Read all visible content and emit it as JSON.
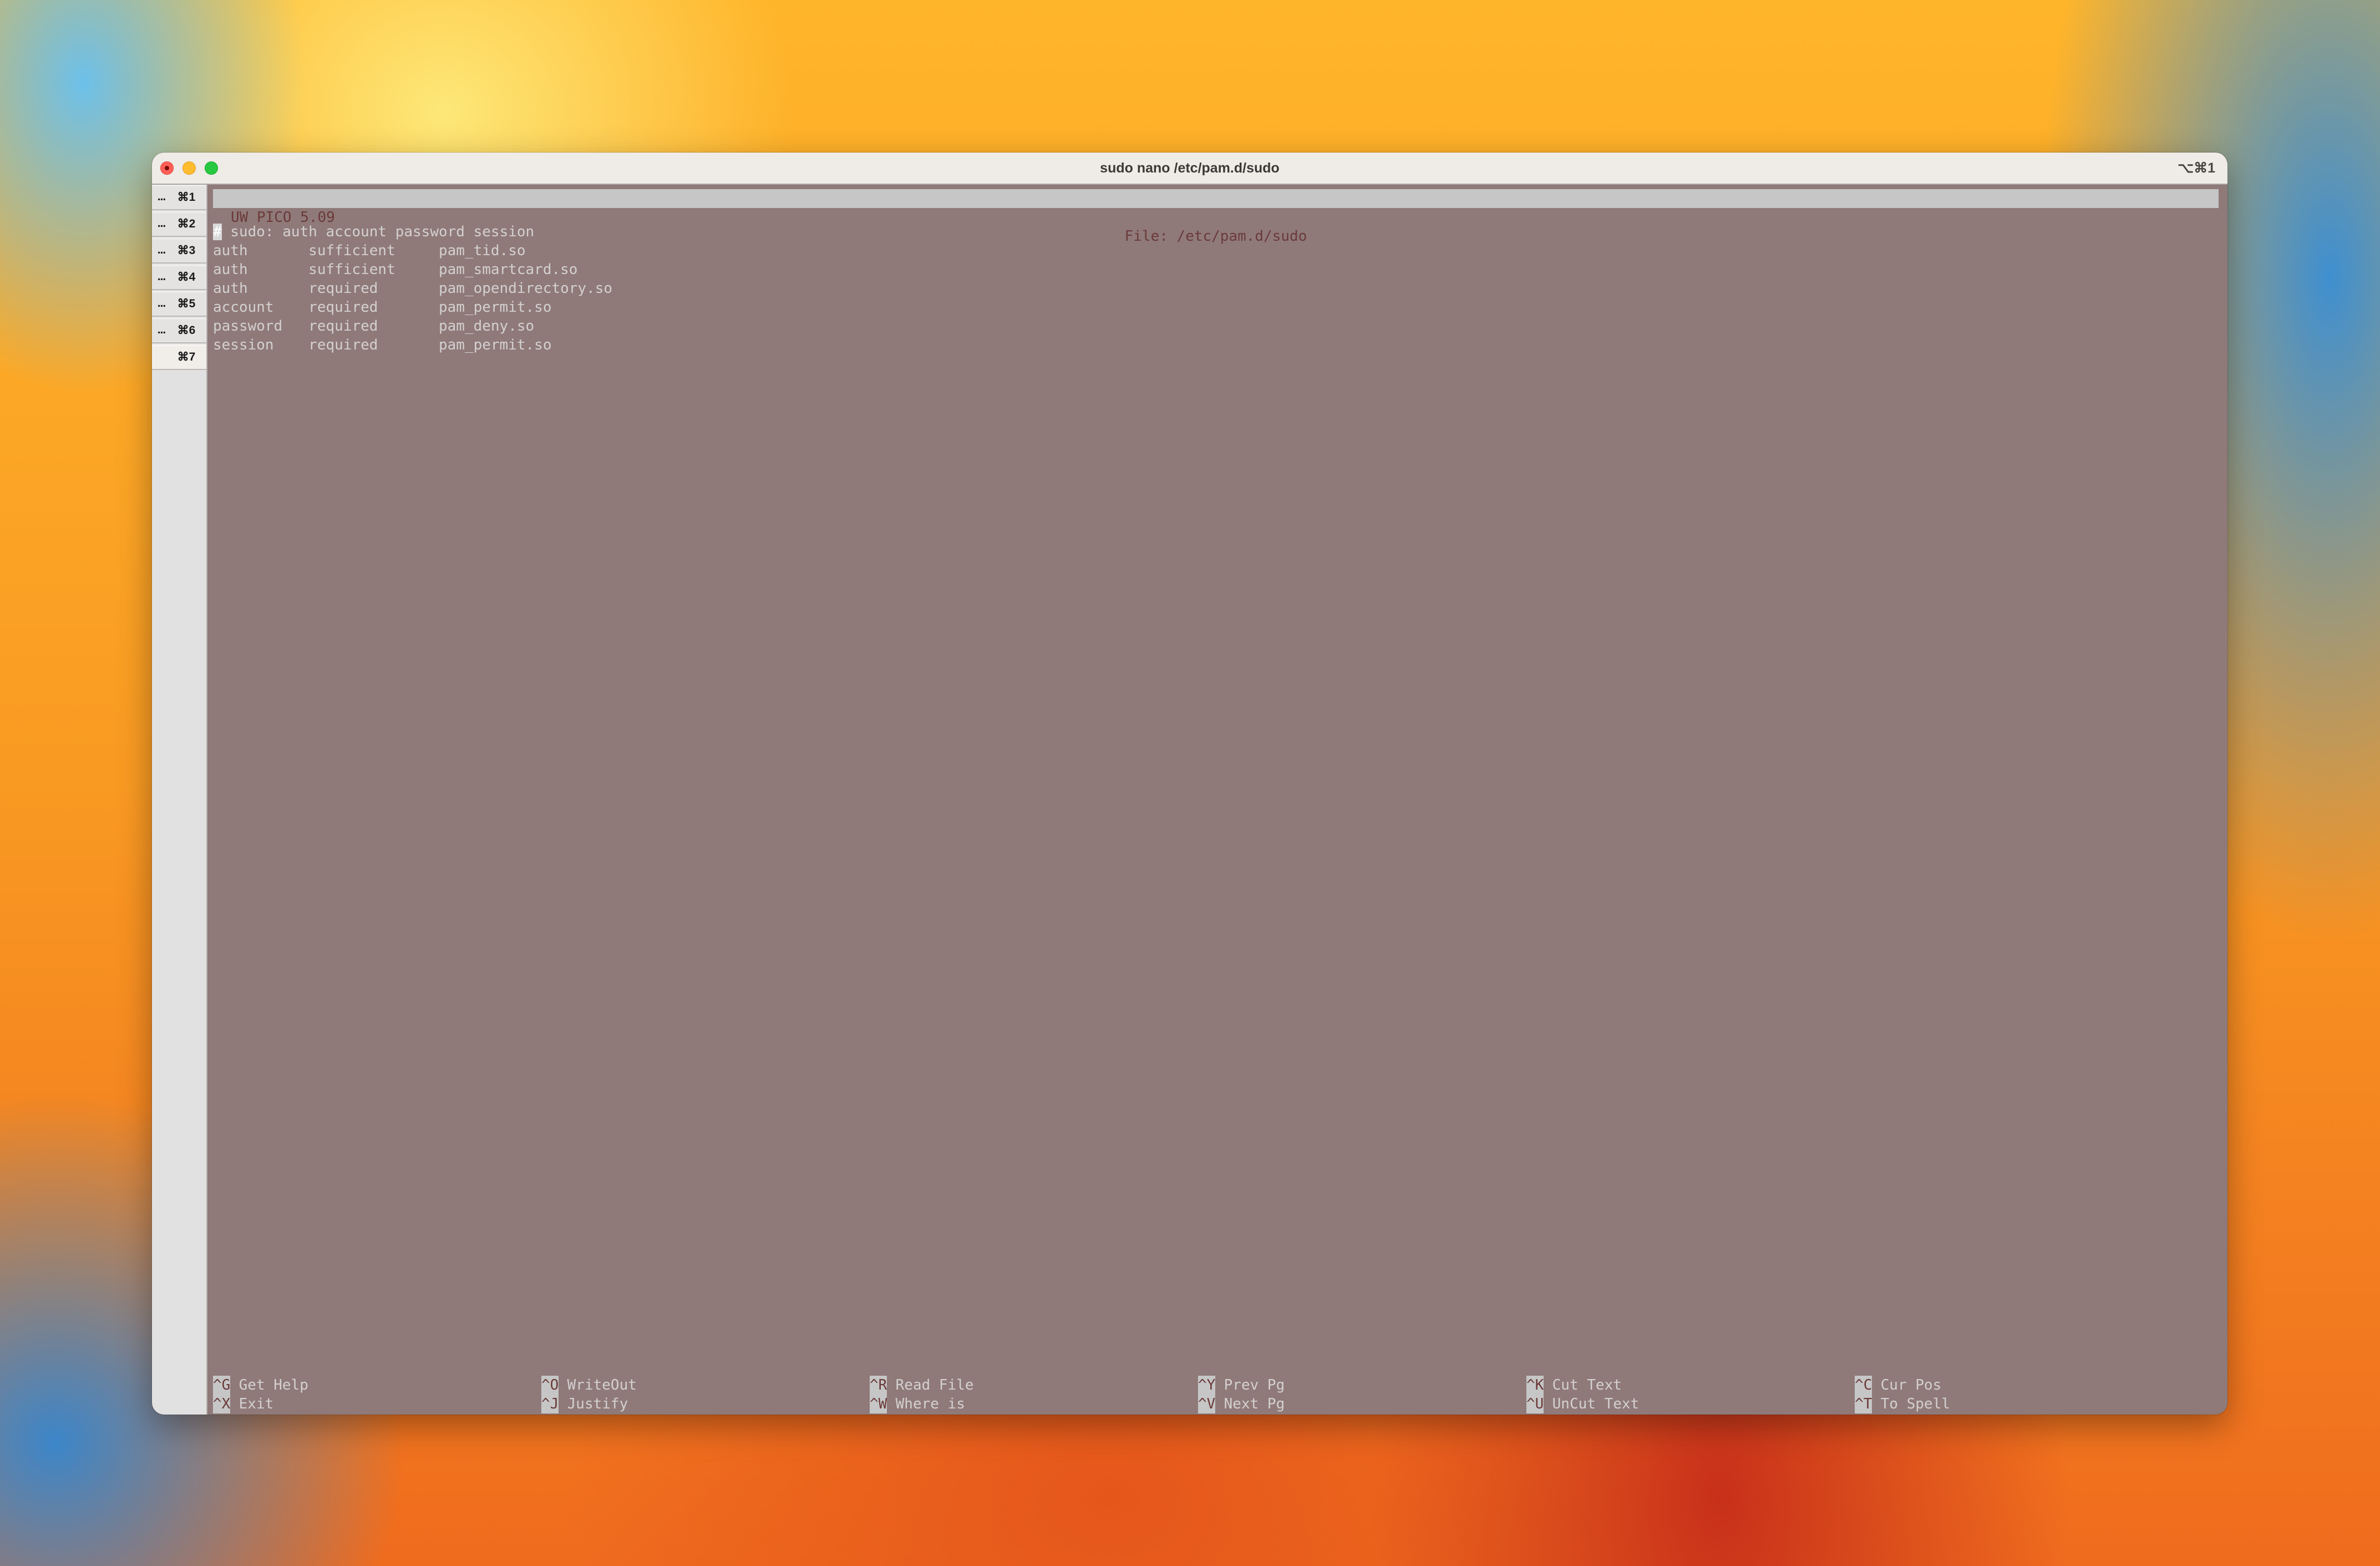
{
  "window": {
    "title": "sudo nano /etc/pam.d/sudo",
    "shortcut": "⌥⌘1"
  },
  "tabs": [
    {
      "dots": "...",
      "key": "⌘1",
      "active": false
    },
    {
      "dots": "...",
      "key": "⌘2",
      "active": false
    },
    {
      "dots": "...",
      "key": "⌘3",
      "active": false
    },
    {
      "dots": "...",
      "key": "⌘4",
      "active": false
    },
    {
      "dots": "...",
      "key": "⌘5",
      "active": false
    },
    {
      "dots": "...",
      "key": "⌘6",
      "active": false
    },
    {
      "dots": "",
      "key": "⌘7",
      "active": true
    }
  ],
  "editor": {
    "version": "UW PICO 5.09",
    "file_label": "File: /etc/pam.d/sudo",
    "cursor_char": "#",
    "first_line_rest": " sudo: auth account password session",
    "lines": [
      "auth       sufficient     pam_tid.so",
      "auth       sufficient     pam_smartcard.so",
      "auth       required       pam_opendirectory.so",
      "account    required       pam_permit.so",
      "password   required       pam_deny.so",
      "session    required       pam_permit.so"
    ]
  },
  "help": [
    {
      "top": {
        "key": "^G",
        "label": " Get Help"
      },
      "bottom": {
        "key": "^X",
        "label": " Exit"
      }
    },
    {
      "top": {
        "key": "^O",
        "label": " WriteOut"
      },
      "bottom": {
        "key": "^J",
        "label": " Justify"
      }
    },
    {
      "top": {
        "key": "^R",
        "label": " Read File"
      },
      "bottom": {
        "key": "^W",
        "label": " Where is"
      }
    },
    {
      "top": {
        "key": "^Y",
        "label": " Prev Pg"
      },
      "bottom": {
        "key": "^V",
        "label": " Next Pg"
      }
    },
    {
      "top": {
        "key": "^K",
        "label": " Cut Text"
      },
      "bottom": {
        "key": "^U",
        "label": " UnCut Text"
      }
    },
    {
      "top": {
        "key": "^C",
        "label": " Cur Pos"
      },
      "bottom": {
        "key": "^T",
        "label": " To Spell"
      }
    }
  ]
}
